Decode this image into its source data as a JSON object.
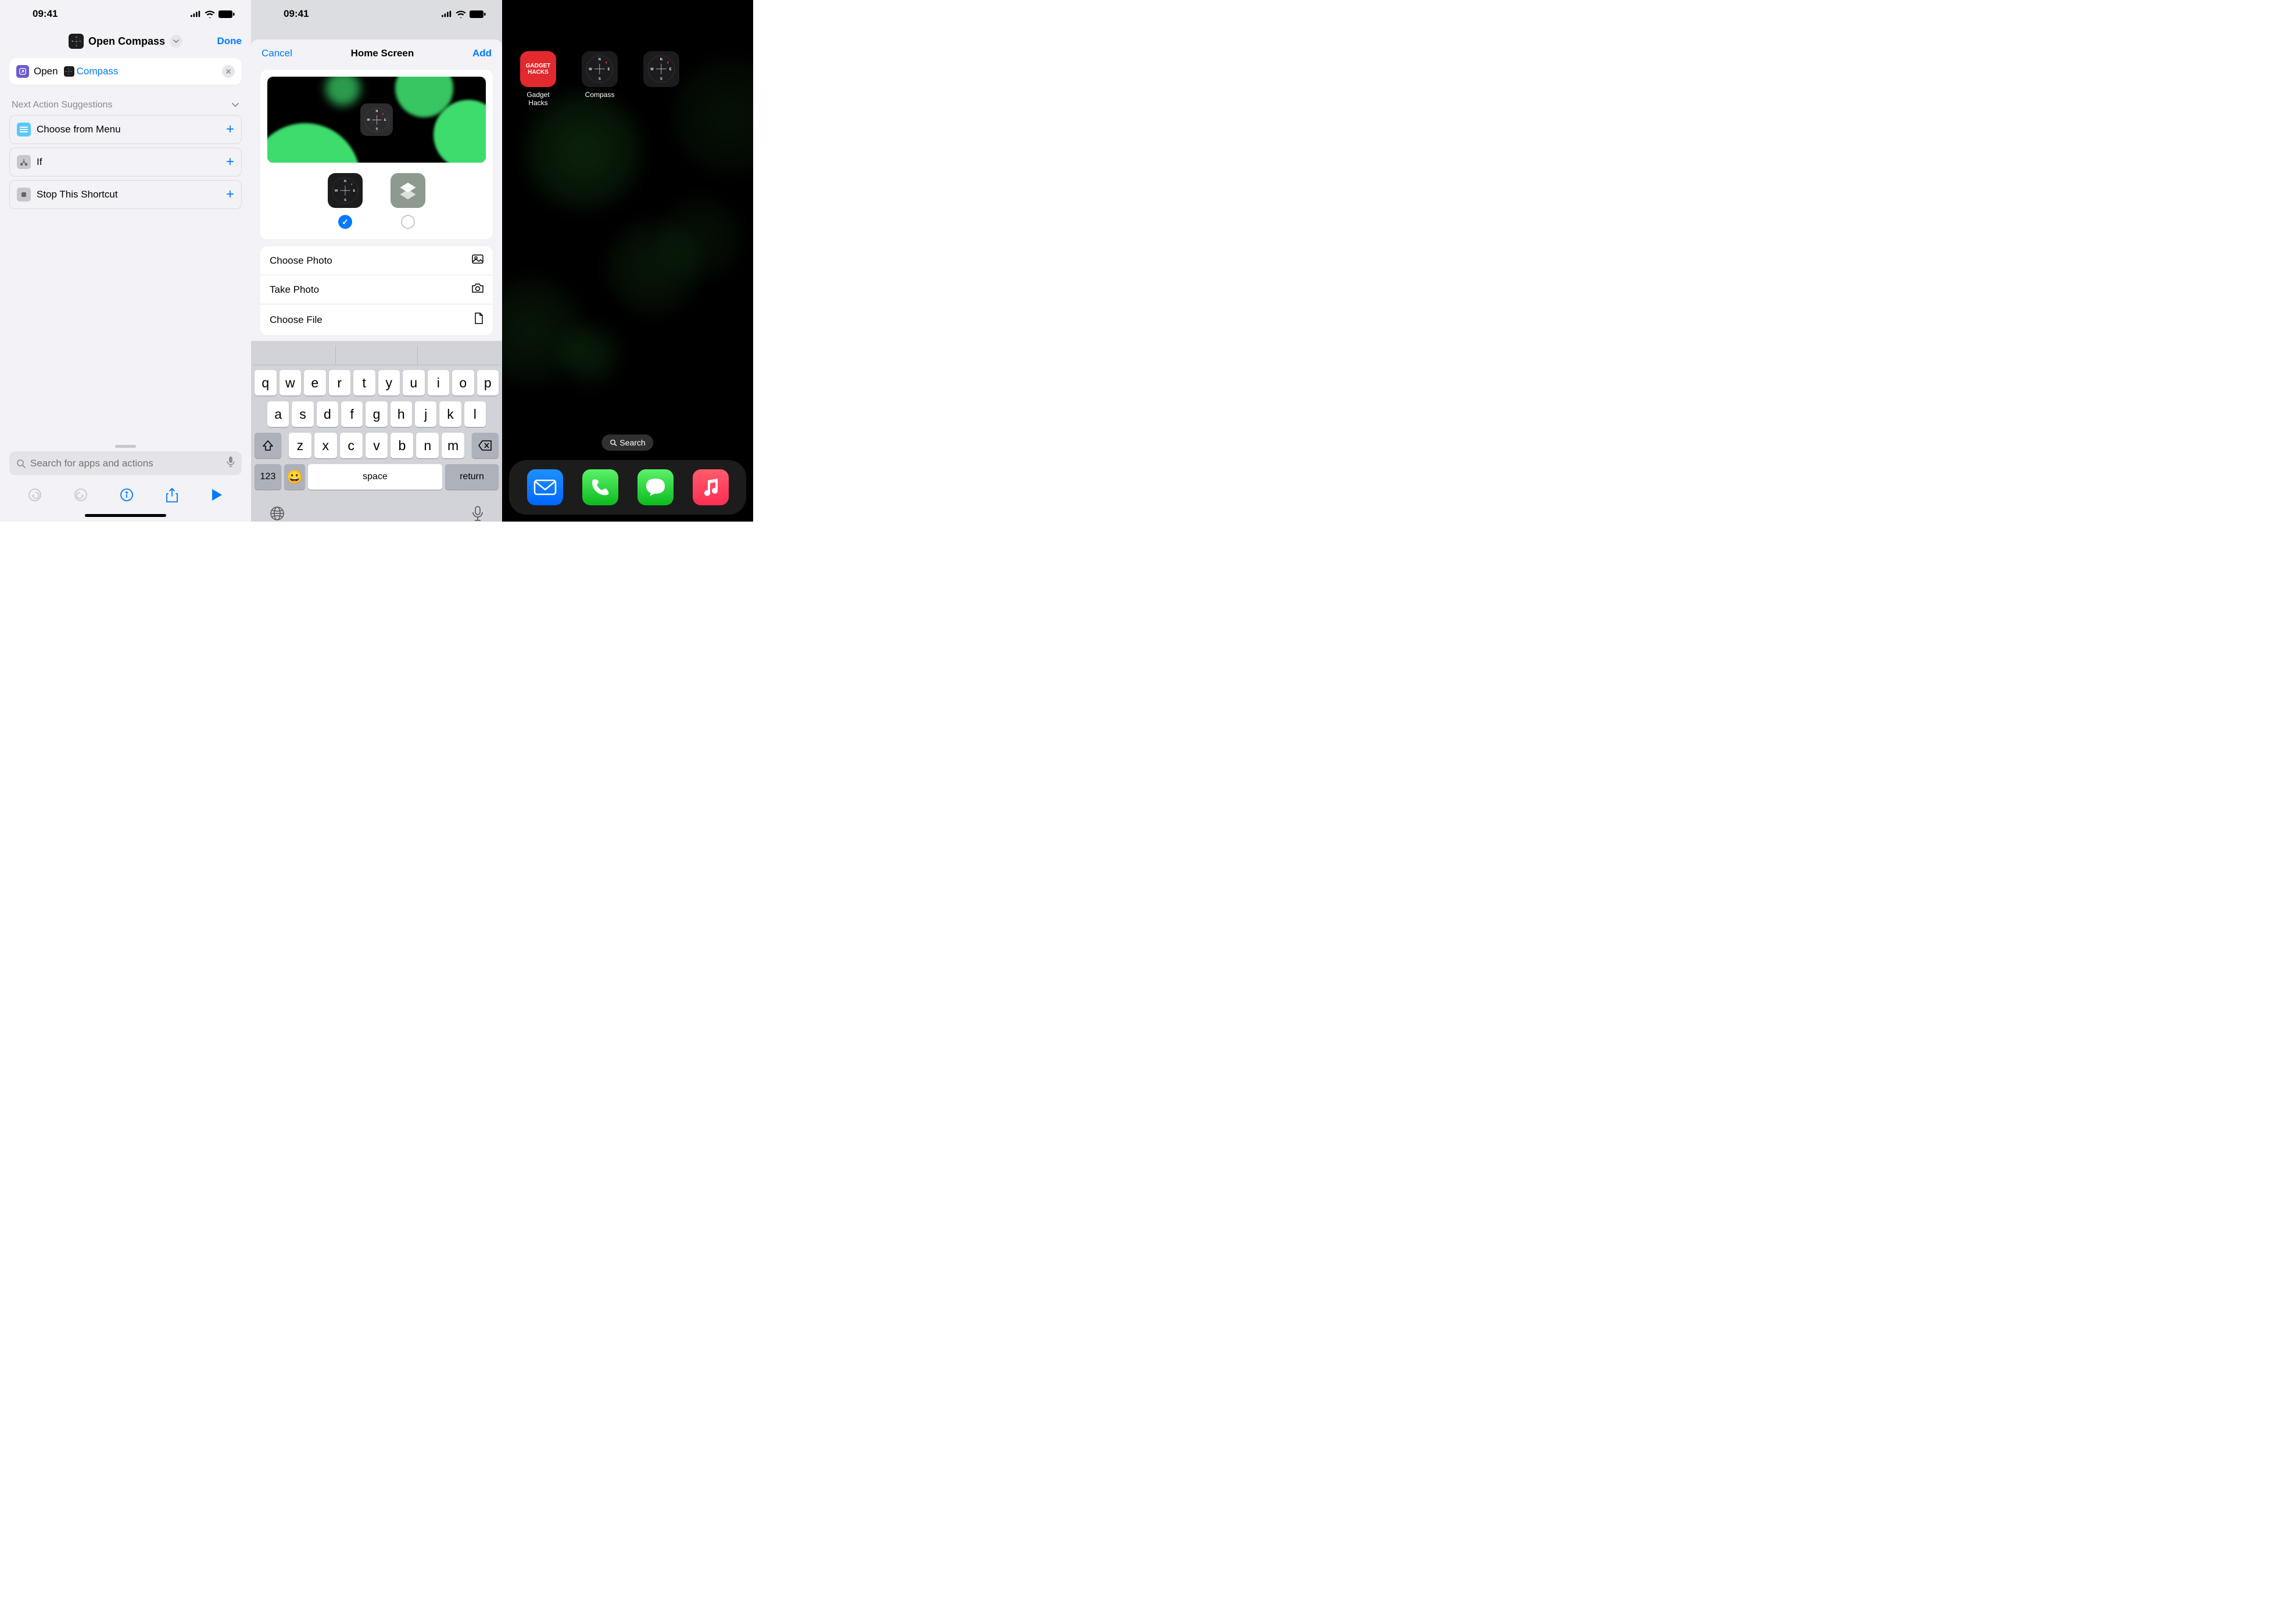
{
  "status": {
    "time": "09:41"
  },
  "colors": {
    "accent": "#007aff"
  },
  "pane1": {
    "header_title": "Open Compass",
    "done": "Done",
    "action": {
      "open": "Open",
      "app": "Compass"
    },
    "suggestions_header": "Next Action Suggestions",
    "suggestions": [
      {
        "label": "Choose from Menu"
      },
      {
        "label": "If"
      },
      {
        "label": "Stop This Shortcut"
      }
    ],
    "search_placeholder": "Search for apps and actions"
  },
  "pane2": {
    "cancel": "Cancel",
    "title": "Home Screen",
    "add": "Add",
    "options": [
      {
        "label": "Choose Photo"
      },
      {
        "label": "Take Photo"
      },
      {
        "label": "Choose File"
      }
    ],
    "keyboard": {
      "row1": [
        "q",
        "w",
        "e",
        "r",
        "t",
        "y",
        "u",
        "i",
        "o",
        "p"
      ],
      "row2": [
        "a",
        "s",
        "d",
        "f",
        "g",
        "h",
        "j",
        "k",
        "l"
      ],
      "row3": [
        "z",
        "x",
        "c",
        "v",
        "b",
        "n",
        "m"
      ],
      "numbers": "123",
      "space": "space",
      "return": "return"
    }
  },
  "pane3": {
    "apps": [
      {
        "label": "Gadget Hacks",
        "text": "GADGET HACKS"
      },
      {
        "label": "Compass"
      },
      {
        "label": ""
      }
    ],
    "search": "Search",
    "dock": [
      "mail",
      "phone",
      "messages",
      "music"
    ]
  }
}
